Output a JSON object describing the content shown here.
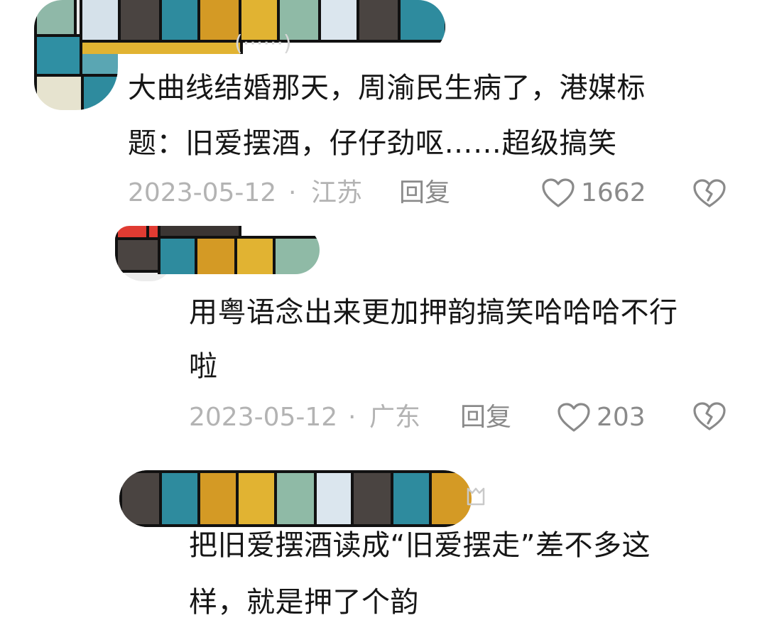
{
  "comments": [
    {
      "text_lines": [
        "大曲线结婚那天，周渝民生病了，港媒标",
        "题：旧爱摆酒，仔仔劲呕……超级搞笑"
      ],
      "date": "2023-05-12",
      "separator": "·",
      "location": "江苏",
      "reply_label": "回复",
      "likes": "1662"
    },
    {
      "text_lines": [
        "用粤语念出来更加押韵搞笑哈哈哈不行",
        "啦"
      ],
      "date": "2023-05-12",
      "separator": "·",
      "location": "广东",
      "reply_label": "回复",
      "likes": "203"
    },
    {
      "text_lines": [
        "把旧爱摆酒读成“旧爱摆走”差不多这",
        "样，就是押了个韵"
      ]
    }
  ],
  "icons": {
    "like": "heart-outline-icon",
    "dislike": "broken-heart-icon"
  },
  "colors": {
    "text": "#161616",
    "meta": "#b3b3b3",
    "action": "#8a8a8a"
  }
}
